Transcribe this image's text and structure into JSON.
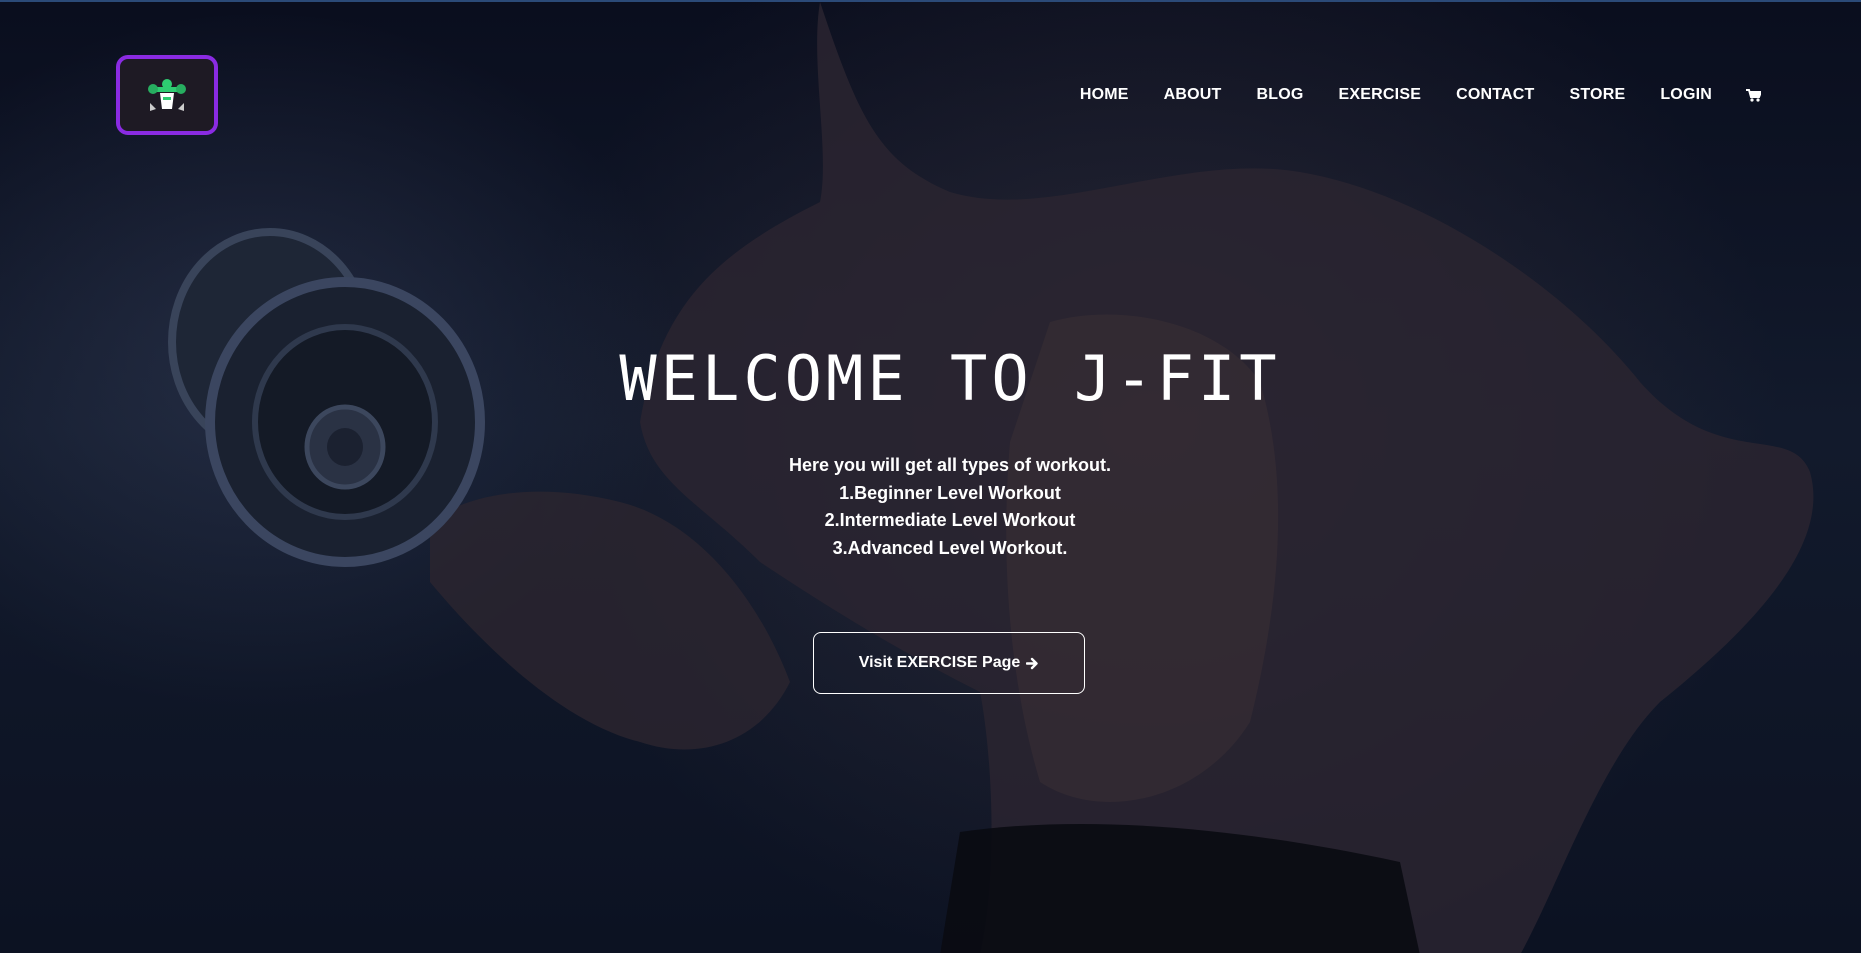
{
  "nav": {
    "logo_icon": "gym-logo-icon",
    "links": [
      "HOME",
      "ABOUT",
      "BLOG",
      "EXERCISE",
      "CONTACT",
      "STORE",
      "LOGIN"
    ],
    "cart_icon": "cart-icon"
  },
  "hero": {
    "title": "WELCOME TO J-FIT",
    "lines": [
      "Here you will get all types of workout.",
      "1.Beginner Level Workout",
      "2.Intermediate Level Workout",
      "3.Advanced Level Workout."
    ],
    "cta_label": "Visit EXERCISE Page",
    "cta_icon": "arrow-right-icon"
  },
  "colors": {
    "logo_border": "#8a2be2",
    "text": "#ffffff",
    "background": "#0b1020"
  }
}
